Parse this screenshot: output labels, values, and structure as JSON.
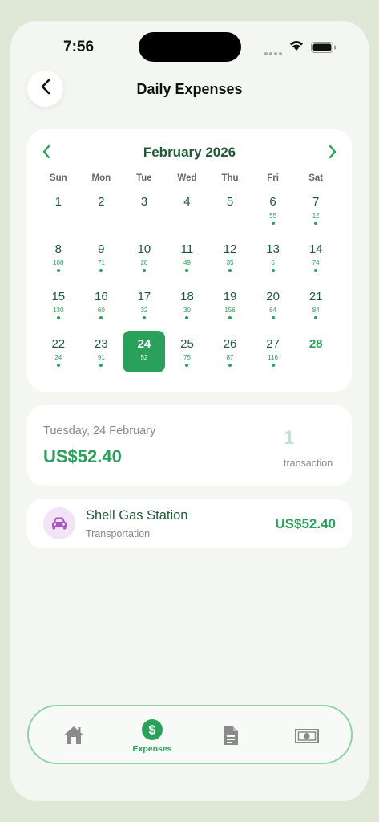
{
  "status_bar": {
    "time": "7:56"
  },
  "header": {
    "title": "Daily Expenses",
    "back_icon": "chevron-left-icon"
  },
  "calendar": {
    "month_label": "February 2026",
    "weekdays": [
      "Sun",
      "Mon",
      "Tue",
      "Wed",
      "Thu",
      "Fri",
      "Sat"
    ],
    "selected_day": "24",
    "weeks": [
      [
        {
          "day": "1",
          "amount": ""
        },
        {
          "day": "2",
          "amount": ""
        },
        {
          "day": "3",
          "amount": ""
        },
        {
          "day": "4",
          "amount": ""
        },
        {
          "day": "5",
          "amount": ""
        },
        {
          "day": "6",
          "amount": "55"
        },
        {
          "day": "7",
          "amount": "12"
        }
      ],
      [
        {
          "day": "8",
          "amount": "108"
        },
        {
          "day": "9",
          "amount": "71"
        },
        {
          "day": "10",
          "amount": "28"
        },
        {
          "day": "11",
          "amount": "49"
        },
        {
          "day": "12",
          "amount": "35"
        },
        {
          "day": "13",
          "amount": "6"
        },
        {
          "day": "14",
          "amount": "74"
        }
      ],
      [
        {
          "day": "15",
          "amount": "130"
        },
        {
          "day": "16",
          "amount": "60"
        },
        {
          "day": "17",
          "amount": "32"
        },
        {
          "day": "18",
          "amount": "30"
        },
        {
          "day": "19",
          "amount": "156"
        },
        {
          "day": "20",
          "amount": "64"
        },
        {
          "day": "21",
          "amount": "84"
        }
      ],
      [
        {
          "day": "22",
          "amount": "24"
        },
        {
          "day": "23",
          "amount": "91"
        },
        {
          "day": "24",
          "amount": "52"
        },
        {
          "day": "25",
          "amount": "75"
        },
        {
          "day": "26",
          "amount": "87"
        },
        {
          "day": "27",
          "amount": "116"
        },
        {
          "day": "28",
          "amount": ""
        }
      ]
    ]
  },
  "summary": {
    "date": "Tuesday, 24 February",
    "total": "US$52.40",
    "count": "1",
    "count_label": "transaction"
  },
  "transactions": [
    {
      "name": "Shell Gas Station",
      "category": "Transportation",
      "amount": "US$52.40",
      "icon": "car-icon"
    }
  ],
  "bottom_nav": {
    "items": [
      {
        "icon": "home-icon",
        "label": ""
      },
      {
        "icon": "dollar-icon",
        "label": "Expenses"
      },
      {
        "icon": "document-icon",
        "label": ""
      },
      {
        "icon": "banknote-icon",
        "label": ""
      }
    ]
  },
  "colors": {
    "accent": "#2aa15a",
    "dark_green": "#1e5a35",
    "background": "#dfe8d7"
  }
}
